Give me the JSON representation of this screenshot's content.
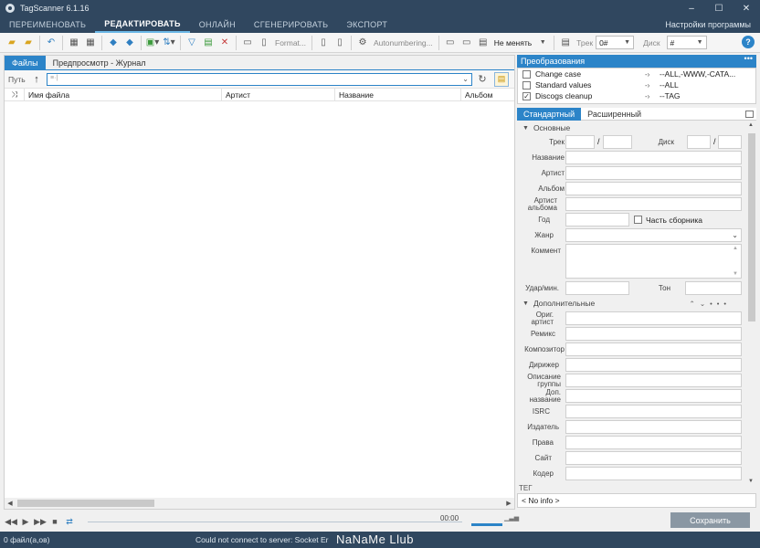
{
  "window": {
    "title": "TagScanner 6.1.16",
    "minimize": "–",
    "maximize": "☐",
    "close": "✕"
  },
  "menu": {
    "tabs": [
      "ПЕРЕИМЕНОВАТЬ",
      "РЕДАКТИРОВАТЬ",
      "ОНЛАЙН",
      "СГЕНЕРИРОВАТЬ",
      "ЭКСПОРТ"
    ],
    "active": 1,
    "settings": "Настройки программы"
  },
  "toolbar": {
    "format_label": "Format...",
    "autonumbering_label": "Autonumbering...",
    "mode_value": "Не менять",
    "track_label": "Трек",
    "track_value": "0#",
    "disc_label": "Диск",
    "disc_value": "#",
    "help": "?"
  },
  "left": {
    "tabs": [
      "Файлы",
      "Предпросмотр - Журнал"
    ],
    "path_label": "Путь",
    "columns": [
      "Имя файла",
      "Артист",
      "Название",
      "Альбом"
    ]
  },
  "player": {
    "time": "00:00"
  },
  "status": {
    "files": "0 файл(а,ов)",
    "message": "Could not connect to server: Socket Er",
    "watermark": "NaNaMe Llub"
  },
  "transforms": {
    "title": "Преобразования",
    "items": [
      {
        "name": "Change case",
        "value": "--ALL,-WWW,-CATA...",
        "checked": false
      },
      {
        "name": "Standard values",
        "value": "--ALL",
        "checked": false
      },
      {
        "name": "Discogs cleanup",
        "value": "--TAG",
        "checked": true
      }
    ]
  },
  "editor": {
    "tabs": [
      "Стандартный",
      "Расширенный"
    ],
    "basic_section": "Основные",
    "extra_section": "Дополнительные",
    "labels": {
      "track": "Трек",
      "disc": "Диск",
      "title": "Название",
      "artist": "Артист",
      "album": "Альбом",
      "album_artist": "Артист альбома",
      "year": "Год",
      "compilation": "Часть сборника",
      "genre": "Жанр",
      "comment": "Коммент",
      "bpm": "Удар/мин.",
      "key": "Тон",
      "orig_artist": "Ориг. артист",
      "remix": "Ремикс",
      "composer": "Композитор",
      "conductor": "Дирижер",
      "group_desc": "Описание группы",
      "subtitle": "Доп. название",
      "isrc": "ISRC",
      "publisher": "Издатель",
      "rights": "Права",
      "site": "Сайт",
      "encoder": "Кодер"
    },
    "tag_label": "ТЕГ",
    "tag_info": "< No info >"
  },
  "save_button": "Сохранить"
}
